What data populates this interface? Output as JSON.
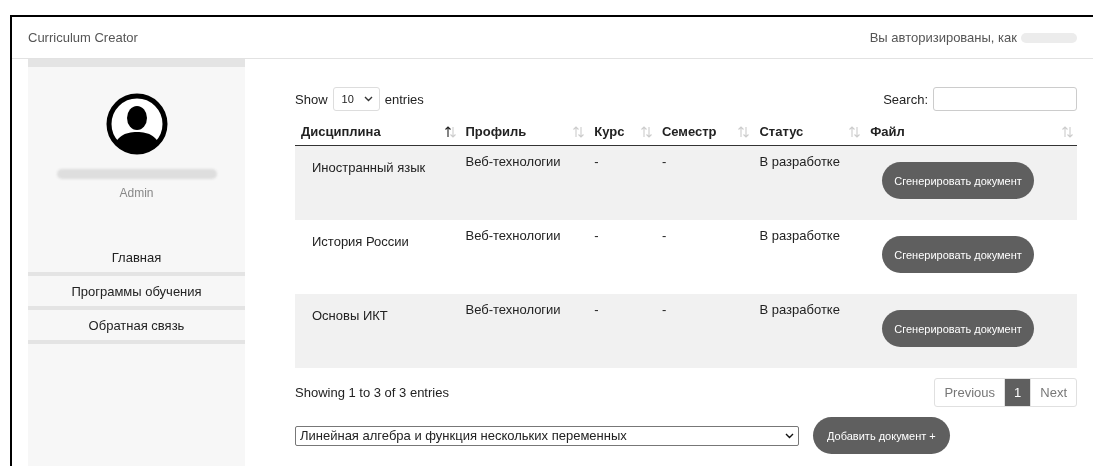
{
  "header": {
    "title": "Curriculum Creator",
    "auth_text": "Вы авторизированы, как"
  },
  "sidebar": {
    "role": "Admin",
    "items": [
      {
        "label": "Главная",
        "selected": false
      },
      {
        "label": "Программы обучения",
        "selected": false
      },
      {
        "label": "Обратная связь",
        "selected": false
      }
    ]
  },
  "table_controls": {
    "show_label": "Show",
    "page_size": "10",
    "entries_label": "entries",
    "search_label": "Search:"
  },
  "table": {
    "columns": [
      {
        "label": "Дисциплина",
        "sorted": true
      },
      {
        "label": "Профиль",
        "sorted": false
      },
      {
        "label": "Курс",
        "sorted": false
      },
      {
        "label": "Семестр",
        "sorted": false
      },
      {
        "label": "Статус",
        "sorted": false
      },
      {
        "label": "Файл",
        "sorted": false
      }
    ],
    "rows": [
      {
        "discipline": "Иностранный язык",
        "profile": "Веб-технологии",
        "course": "-",
        "semester": "-",
        "status": "В разработке",
        "action": "Сгенерировать документ"
      },
      {
        "discipline": "История России",
        "profile": "Веб-технологии",
        "course": "-",
        "semester": "-",
        "status": "В разработке",
        "action": "Сгенерировать документ"
      },
      {
        "discipline": "Основы ИКТ",
        "profile": "Веб-технологии",
        "course": "-",
        "semester": "-",
        "status": "В разработке",
        "action": "Сгенерировать документ"
      }
    ]
  },
  "info": "Showing 1 to 3 of 3 entries",
  "pagination": [
    {
      "label": "Previous",
      "selected": false
    },
    {
      "label": "1",
      "selected": true
    },
    {
      "label": "Next",
      "selected": false
    }
  ],
  "add_form": {
    "discipline": "Линейная алгебра и функция нескольких переменных",
    "button": "Добавить документ +"
  }
}
